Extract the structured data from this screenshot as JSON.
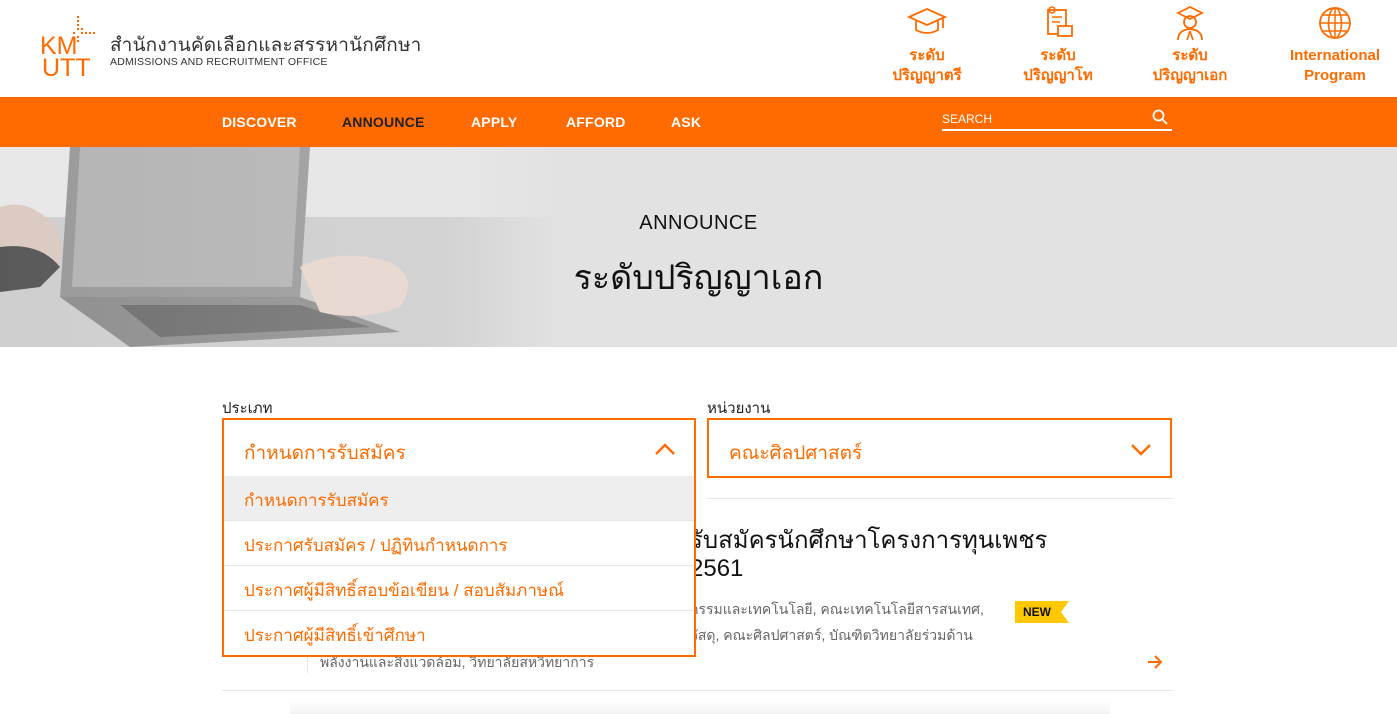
{
  "brand": {
    "logo_text_top": "KM",
    "logo_text_bottom": "UTT",
    "name_th": "สำนักงานคัดเลือกและสรรหานักศึกษา",
    "name_en": "ADMISSIONS AND RECRUITMENT OFFICE",
    "accent_color": "#ff6b00"
  },
  "quick_links": [
    {
      "icon": "graduation-cap-icon",
      "line1": "ระดับ",
      "line2": "ปริญญาตรี"
    },
    {
      "icon": "certificate-icon",
      "line1": "ระดับ",
      "line2": "ปริญญาโท"
    },
    {
      "icon": "graduate-person-icon",
      "line1": "ระดับ",
      "line2": "ปริญญาเอก"
    },
    {
      "icon": "globe-icon",
      "line1": "International",
      "line2": "Program"
    }
  ],
  "nav": {
    "items": [
      "DISCOVER",
      "ANNOUNCE",
      "APPLY",
      "AFFORD",
      "ASK"
    ],
    "active": "ANNOUNCE",
    "search_placeholder": "SEARCH"
  },
  "banner": {
    "subtitle": "ANNOUNCE",
    "title": "ระดับปริญญาเอก"
  },
  "filters": {
    "type_label": "ประเภท",
    "type_value": "กำหนดการรับสมัคร",
    "type_options": [
      "กำหนดการรับสมัคร",
      "ประกาศรับสมัคร / ปฏิทินกำหนดการ",
      "ประกาศผู้มีสิทธิ์สอบข้อเขียน / สอบสัมภาษณ์",
      "ประกาศผู้มีสิทธิ์เข้าศึกษา"
    ],
    "dept_label": "หน่วยงาน",
    "dept_value": "คณะศิลปศาสตร์"
  },
  "announcement": {
    "title_line1": "รับสมัครนักศึกษาโครงการทุนเพชร",
    "title_line2": "2561",
    "desc_line1": "กรรมและเทคโนโลยี, คณะเทคโนโลยีสารสนเทศ,",
    "desc_line2": "วัสดุ, คณะศิลปศาสตร์, บัณฑิตวิทยาลัยร่วมด้าน",
    "desc_line3": "พลังงานและสิ่งแวดล้อม, วิทยาลัยสหวิทยาการ",
    "badge": "NEW",
    "badge_color": "#ffc800"
  }
}
